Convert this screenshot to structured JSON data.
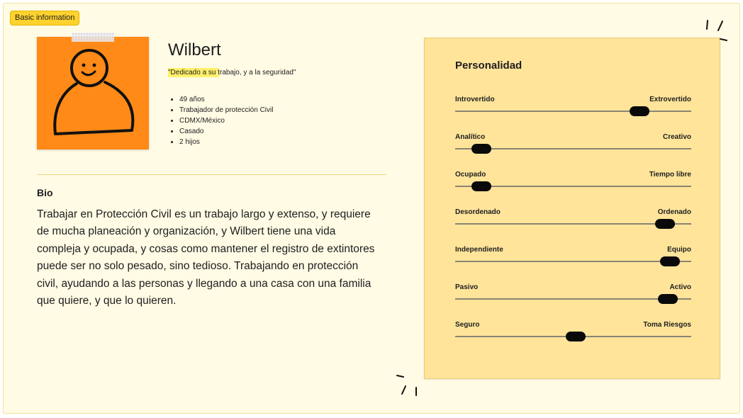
{
  "section_tag": "Basic information",
  "persona": {
    "name": "Wilbert",
    "quote": "\"Dedicado a su trabajo, y a la seguridad\"",
    "facts": [
      "49 años",
      "Trabajador de protección Civil",
      "CDMX/México",
      "Casado",
      "2 hijos"
    ],
    "avatar_icon": "person-doodle-icon",
    "photo_color": "#ff8a17"
  },
  "bio": {
    "title": "Bio",
    "text": "Trabajar en Protección Civil es un trabajo largo y extenso, y requiere de mucha planeación y organización, y Wilbert tiene una vida compleja y ocupada, y cosas como mantener el registro de extintores puede ser no solo pesado, sino tedioso. Trabajando en protección civil, ayudando a las personas y llegando a una casa con una familia que quiere, y que lo quieren."
  },
  "personality": {
    "title": "Personalidad",
    "traits": [
      {
        "left": "Introvertido",
        "right": "Extrovertido",
        "level": 0.78
      },
      {
        "left": "Analítico",
        "right": "Creativo",
        "level": 0.11
      },
      {
        "left": "Ocupado",
        "right": "Tiempo libre",
        "level": 0.11
      },
      {
        "left": "Desordenado",
        "right": "Ordenado",
        "level": 0.89
      },
      {
        "left": "Independiente",
        "right": "Equipo",
        "level": 0.91
      },
      {
        "left": "Pasivo",
        "right": "Activo",
        "level": 0.9
      },
      {
        "left": "Seguro",
        "right": "Toma Riesgos",
        "level": 0.51
      }
    ]
  },
  "colors": {
    "board_bg": "#fffbe5",
    "tag_bg": "#ffd22e",
    "sticky_bg": "#ffe49a",
    "highlight": "#fff06a"
  }
}
